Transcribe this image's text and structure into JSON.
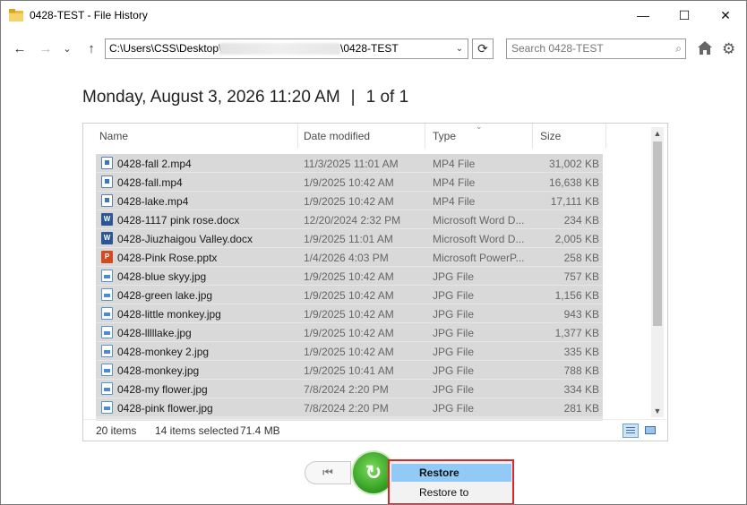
{
  "window": {
    "title": "0428-TEST - File History",
    "minimize": "—",
    "maximize": "☐",
    "close": "✕"
  },
  "nav": {
    "back": "←",
    "forward": "→",
    "recent": "⌄",
    "up": "↑",
    "address_prefix": "C:\\Users\\CSS\\Desktop\\",
    "address_suffix": "\\0428-TEST",
    "dropdown": "⌄",
    "refresh": "⟳",
    "search_placeholder": "Search 0428-TEST",
    "search_icon": "⌕",
    "gear": "⚙"
  },
  "heading": {
    "datetime": "Monday, August 3, 2026 11:20 AM",
    "separator": "|",
    "position": "1 of 1"
  },
  "columns": {
    "name": "Name",
    "date": "Date modified",
    "type": "Type",
    "size": "Size",
    "sort_indicator": "⌄"
  },
  "files": [
    {
      "name": "0428-fall 2.mp4",
      "date": "11/3/2025 11:01 AM",
      "type": "MP4 File",
      "size": "31,002 KB",
      "icon": "video"
    },
    {
      "name": "0428-fall.mp4",
      "date": "1/9/2025 10:42 AM",
      "type": "MP4 File",
      "size": "16,638 KB",
      "icon": "video"
    },
    {
      "name": "0428-lake.mp4",
      "date": "1/9/2025 10:42 AM",
      "type": "MP4 File",
      "size": "17,111 KB",
      "icon": "video"
    },
    {
      "name": "0428-1117 pink rose.docx",
      "date": "12/20/2024 2:32 PM",
      "type": "Microsoft Word D...",
      "size": "234 KB",
      "icon": "word"
    },
    {
      "name": "0428-Jiuzhaigou Valley.docx",
      "date": "1/9/2025 11:01 AM",
      "type": "Microsoft Word D...",
      "size": "2,005 KB",
      "icon": "word"
    },
    {
      "name": "0428-Pink Rose.pptx",
      "date": "1/4/2026 4:03 PM",
      "type": "Microsoft PowerP...",
      "size": "258 KB",
      "icon": "ppt"
    },
    {
      "name": "0428-blue skyy.jpg",
      "date": "1/9/2025 10:42 AM",
      "type": "JPG File",
      "size": "757 KB",
      "icon": "img"
    },
    {
      "name": "0428-green lake.jpg",
      "date": "1/9/2025 10:42 AM",
      "type": "JPG File",
      "size": "1,156 KB",
      "icon": "img"
    },
    {
      "name": "0428-little monkey.jpg",
      "date": "1/9/2025 10:42 AM",
      "type": "JPG File",
      "size": "943 KB",
      "icon": "img"
    },
    {
      "name": "0428-lllllake.jpg",
      "date": "1/9/2025 10:42 AM",
      "type": "JPG File",
      "size": "1,377 KB",
      "icon": "img"
    },
    {
      "name": "0428-monkey 2.jpg",
      "date": "1/9/2025 10:42 AM",
      "type": "JPG File",
      "size": "335 KB",
      "icon": "img"
    },
    {
      "name": "0428-monkey.jpg",
      "date": "1/9/2025 10:41 AM",
      "type": "JPG File",
      "size": "788 KB",
      "icon": "img"
    },
    {
      "name": "0428-my flower.jpg",
      "date": "7/8/2024 2:20 PM",
      "type": "JPG File",
      "size": "334 KB",
      "icon": "img"
    },
    {
      "name": "0428-pink flower.jpg",
      "date": "7/8/2024 2:20 PM",
      "type": "JPG File",
      "size": "281 KB",
      "icon": "img"
    }
  ],
  "icon_letters": {
    "word": "W",
    "ppt": "P"
  },
  "scroll": {
    "up": "▲",
    "down": "▼"
  },
  "status": {
    "count": "20 items",
    "selected": "14 items selected",
    "size": "71.4 MB"
  },
  "controls": {
    "previous": "⏮",
    "restore_glyph": "↻"
  },
  "menu": {
    "restore": "Restore",
    "restore_to": "Restore to"
  },
  "colors": {
    "selection": "#d9d9d9",
    "menu_highlight": "#91c9f7",
    "annotation_border": "#d9282c",
    "restore_green": "#2f9a1f"
  }
}
